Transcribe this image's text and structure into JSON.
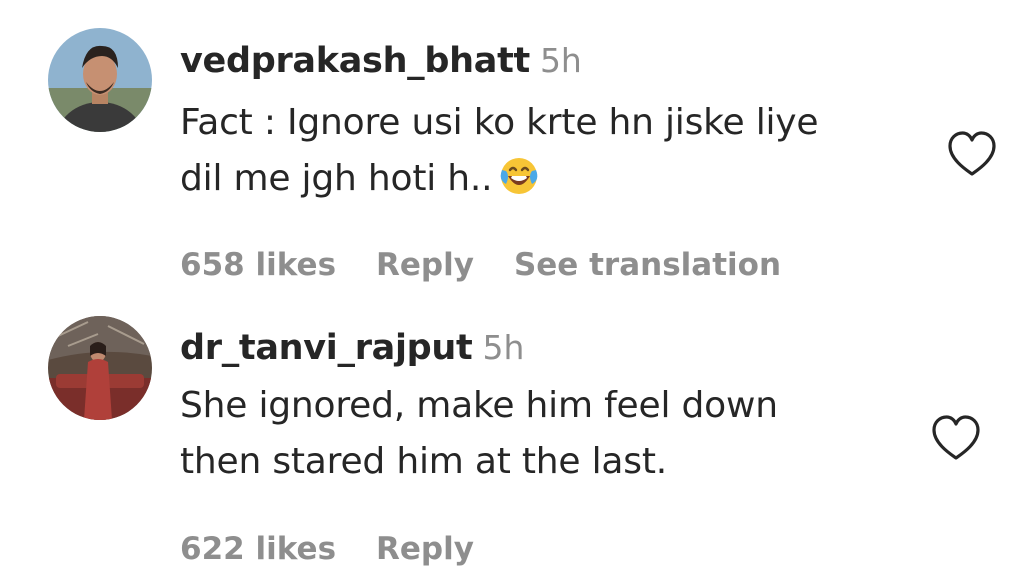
{
  "comments": [
    {
      "username": "vedprakash_bhatt",
      "time": "5h",
      "lines": [
        "Fact : Ignore usi ko krte hn jiske liye",
        "dil me jgh hoti h.."
      ],
      "emoji": "face-with-tears-of-joy",
      "likes": "658 likes",
      "reply": "Reply",
      "translation": "See translation"
    },
    {
      "username": "dr_tanvi_rajput",
      "time": "5h",
      "lines": [
        "She ignored, make him feel down",
        "then stared him at the last."
      ],
      "likes": "622 likes",
      "reply": "Reply"
    }
  ],
  "colors": {
    "primary_text": "#262626",
    "secondary_text": "#8e8e8e"
  },
  "icons": {
    "like": "heart-outline-icon"
  }
}
